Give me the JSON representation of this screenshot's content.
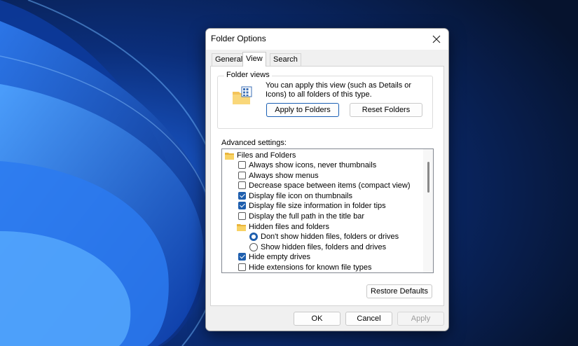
{
  "window": {
    "title": "Folder Options"
  },
  "tabs": [
    {
      "label": "General"
    },
    {
      "label": "View"
    },
    {
      "label": "Search"
    }
  ],
  "active_tab": "View",
  "folder_views": {
    "legend": "Folder views",
    "description": "You can apply this view (such as Details or Icons) to all folders of this type.",
    "apply_button": "Apply to Folders",
    "reset_button": "Reset Folders"
  },
  "advanced": {
    "label": "Advanced settings:",
    "items": [
      {
        "type": "folder",
        "label": "Files and Folders"
      },
      {
        "type": "checkbox",
        "label": "Always show icons, never thumbnails",
        "checked": false
      },
      {
        "type": "checkbox",
        "label": "Always show menus",
        "checked": false
      },
      {
        "type": "checkbox",
        "label": "Decrease space between items (compact view)",
        "checked": false
      },
      {
        "type": "checkbox",
        "label": "Display file icon on thumbnails",
        "checked": true
      },
      {
        "type": "checkbox",
        "label": "Display file size information in folder tips",
        "checked": true
      },
      {
        "type": "checkbox",
        "label": "Display the full path in the title bar",
        "checked": false
      },
      {
        "type": "folder",
        "label": "Hidden files and folders"
      },
      {
        "type": "radio",
        "label": "Don't show hidden files, folders or drives",
        "checked": true
      },
      {
        "type": "radio",
        "label": "Show hidden files, folders and drives",
        "checked": false
      },
      {
        "type": "checkbox",
        "label": "Hide empty drives",
        "checked": true
      },
      {
        "type": "checkbox",
        "label": "Hide extensions for known file types",
        "checked": false
      }
    ]
  },
  "restore_defaults": "Restore Defaults",
  "footer": {
    "ok": "OK",
    "cancel": "Cancel",
    "apply": "Apply"
  },
  "icons": {
    "close": "close-icon",
    "folder": "folder-icon",
    "folder_views": "folder-view-icon"
  },
  "colors": {
    "accent": "#1f5fae",
    "wallpaper_bg": "#071a3d",
    "dialog_bg": "#f0f0f0"
  }
}
